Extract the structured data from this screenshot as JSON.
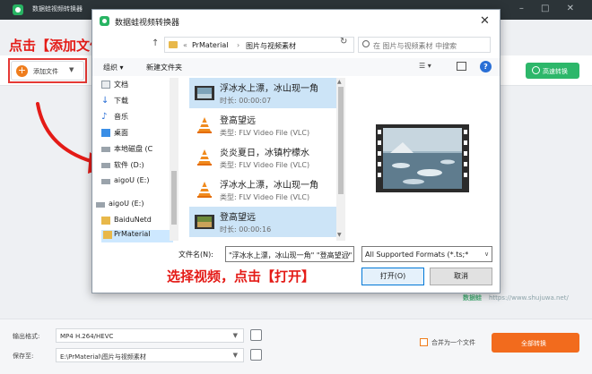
{
  "app": {
    "title": "数据蛙视频转换器",
    "speed_button": "高速转换",
    "add_file": "添加文件",
    "output_format_label": "输出格式:",
    "output_format_value": "MP4 H.264/HEVC",
    "save_to_label": "保存至:",
    "save_to_value": "E:\\PrMaterial\\图片与视频素材",
    "merge_label": "合并为一个文件",
    "convert_all": "全部转换",
    "watermark_brand": "数据蛙",
    "watermark_url": "https://www.shujuwa.net/"
  },
  "annotations": {
    "step1": "点击【添加文件】",
    "step2": "选择视频，点击【打开】"
  },
  "dialog": {
    "title": "数据蛙视频转换器",
    "breadcrumb": [
      "PrMaterial",
      "图片与视频素材"
    ],
    "search_placeholder": "在 图片与视频素材 中搜索",
    "organize": "组织 ▾",
    "new_folder": "新建文件夹",
    "sidebar": [
      {
        "label": "文档",
        "icon": "document-icon"
      },
      {
        "label": "下载",
        "icon": "download-icon"
      },
      {
        "label": "音乐",
        "icon": "music-icon"
      },
      {
        "label": "桌面",
        "icon": "desktop-icon"
      },
      {
        "label": "本地磁盘 (C",
        "icon": "drive-icon"
      },
      {
        "label": "软件 (D:)",
        "icon": "drive-icon"
      },
      {
        "label": "aigoU (E:)",
        "icon": "drive-icon"
      },
      {
        "label": "aigoU (E:)",
        "icon": "drive-icon"
      },
      {
        "label": "BaiduNetd",
        "icon": "folder-icon"
      },
      {
        "label": "PrMaterial",
        "icon": "folder-icon"
      }
    ],
    "files": [
      {
        "name": "浮冰水上漂，冰山现一角",
        "meta": "时长: 00:00:07",
        "thumb": "video",
        "selected": true
      },
      {
        "name": "登高望远",
        "meta": "类型: FLV Video File (VLC)",
        "thumb": "vlc",
        "selected": false
      },
      {
        "name": "炎炎夏日，冰镇柠檬水",
        "meta": "类型: FLV Video File (VLC)",
        "thumb": "vlc",
        "selected": false
      },
      {
        "name": "浮冰水上漂，冰山现一角",
        "meta": "类型: FLV Video File (VLC)",
        "thumb": "vlc",
        "selected": false
      },
      {
        "name": "登高望远",
        "meta": "时长: 00:00:16",
        "thumb": "video",
        "selected": true
      }
    ],
    "filename_label": "文件名(N):",
    "filename_value": "\"浮冰水上漂，冰山现一角\" \"登高望远\"",
    "filetype_value": "All Supported Formats (*.ts;*",
    "open_button": "打开(O)",
    "cancel_button": "取消"
  },
  "colors": {
    "accent_green": "#2db76a",
    "accent_orange": "#f26b1d",
    "annotation_red": "#e41b17",
    "selection_blue": "#cce4f7"
  }
}
